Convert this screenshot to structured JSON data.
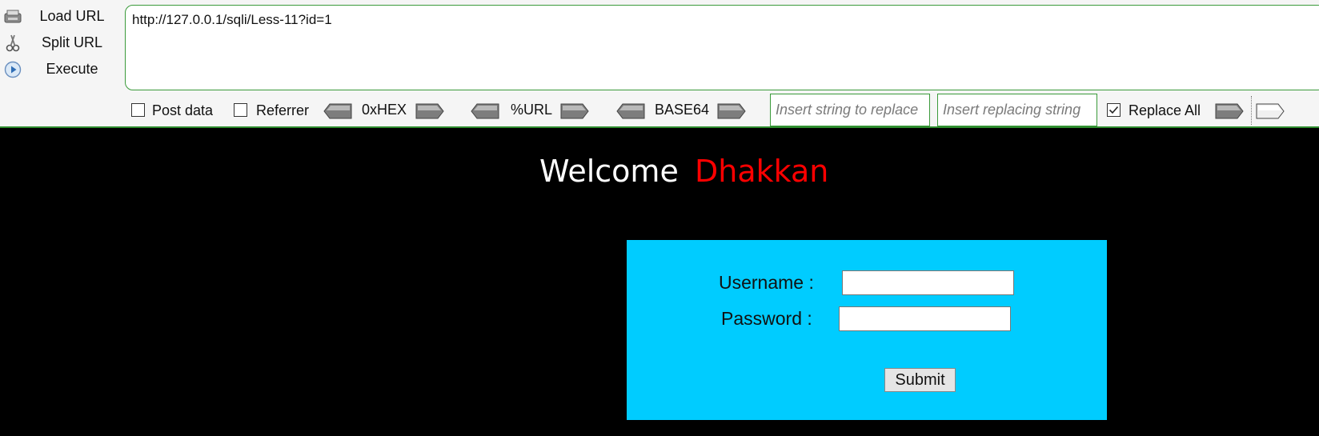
{
  "hackbar": {
    "load_url_label": "Load URL",
    "split_url_label": "Split URL",
    "execute_label": "Execute",
    "url_value": "http://127.0.0.1/sqli/Less-11?id=1",
    "post_data_label": "Post data",
    "post_data_checked": false,
    "referrer_label": "Referrer",
    "referrer_checked": false,
    "hex_label": "0xHEX",
    "url_enc_label": "%URL",
    "base64_label": "BASE64",
    "replace_find_placeholder": "Insert string to replace",
    "replace_with_placeholder": "Insert replacing string",
    "replace_all_label": "Replace All",
    "replace_all_checked": true,
    "accent_color": "#2e8b2e"
  },
  "page": {
    "welcome_text": "Welcome",
    "name_text": "Dhakkan",
    "name_color": "#ff0000",
    "form_bg": "#00ccff",
    "username_label": "Username :",
    "password_label": "Password :",
    "submit_label": "Submit"
  }
}
